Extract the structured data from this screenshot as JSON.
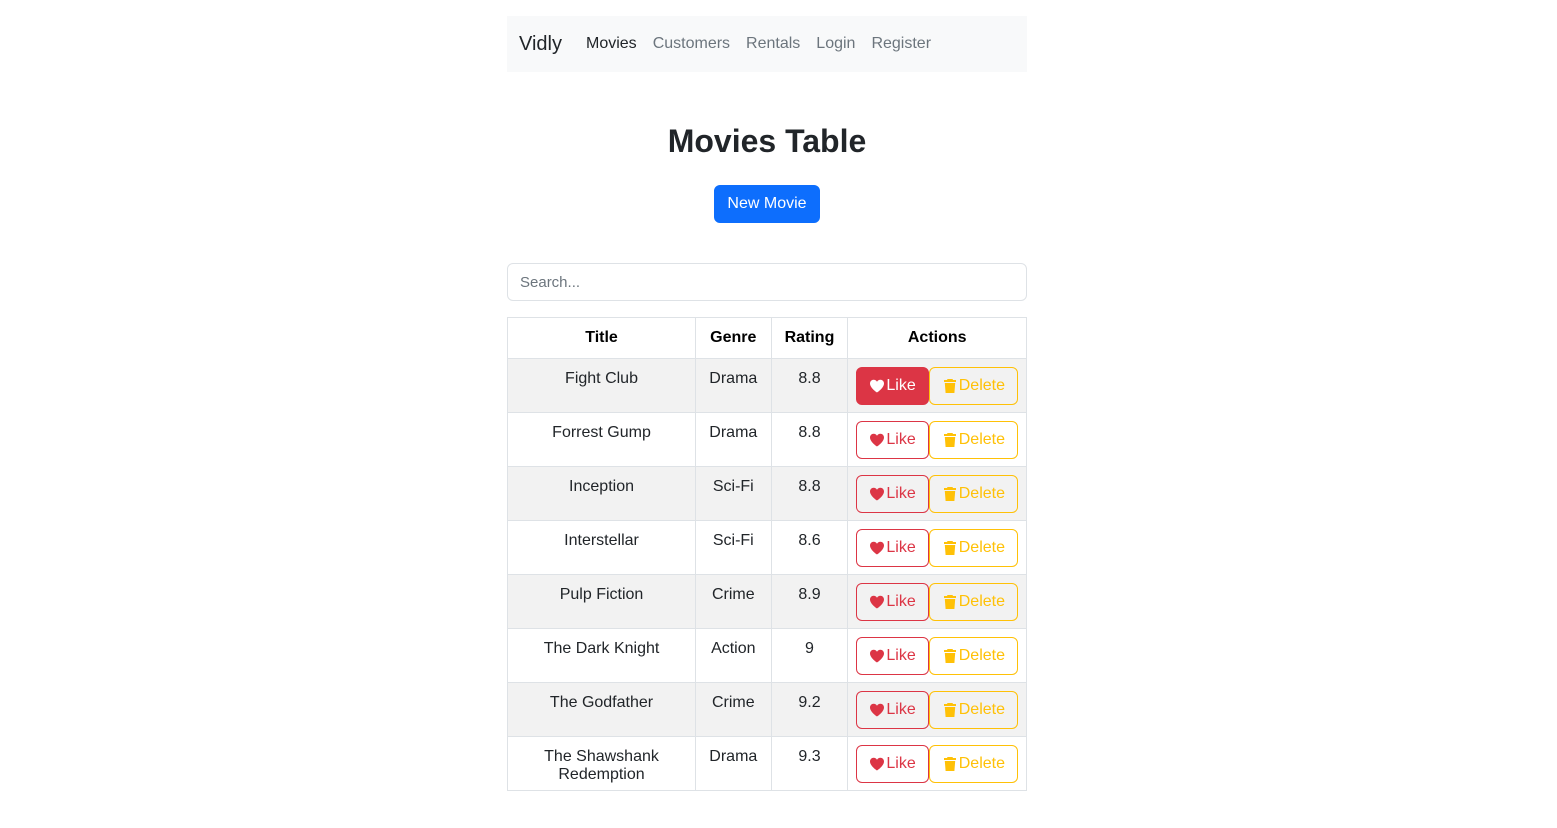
{
  "nav": {
    "brand": "Vidly",
    "links": [
      {
        "label": "Movies",
        "active": true
      },
      {
        "label": "Customers",
        "active": false
      },
      {
        "label": "Rentals",
        "active": false
      },
      {
        "label": "Login",
        "active": false
      },
      {
        "label": "Register",
        "active": false
      }
    ]
  },
  "page": {
    "title": "Movies Table",
    "new_button": "New Movie"
  },
  "search": {
    "placeholder": "Search...",
    "value": ""
  },
  "table": {
    "headers": [
      "Title",
      "Genre",
      "Rating",
      "Actions"
    ],
    "like_label": "Like",
    "delete_label": "Delete",
    "like_icon": "heart-icon",
    "delete_icon": "trash-icon",
    "rows": [
      {
        "title": "Fight Club",
        "genre": "Drama",
        "rating": "8.8",
        "liked": true
      },
      {
        "title": "Forrest Gump",
        "genre": "Drama",
        "rating": "8.8",
        "liked": false
      },
      {
        "title": "Inception",
        "genre": "Sci-Fi",
        "rating": "8.8",
        "liked": false
      },
      {
        "title": "Interstellar",
        "genre": "Sci-Fi",
        "rating": "8.6",
        "liked": false
      },
      {
        "title": "Pulp Fiction",
        "genre": "Crime",
        "rating": "8.9",
        "liked": false
      },
      {
        "title": "The Dark Knight",
        "genre": "Action",
        "rating": "9",
        "liked": false
      },
      {
        "title": "The Godfather",
        "genre": "Crime",
        "rating": "9.2",
        "liked": false
      },
      {
        "title": "The Shawshank Redemption",
        "genre": "Drama",
        "rating": "9.3",
        "liked": false
      }
    ]
  },
  "colors": {
    "primary": "#0d6efd",
    "danger": "#dc3545",
    "warning": "#ffc107",
    "navbar_bg": "#f8f9fa",
    "stripe": "#f2f2f2"
  }
}
